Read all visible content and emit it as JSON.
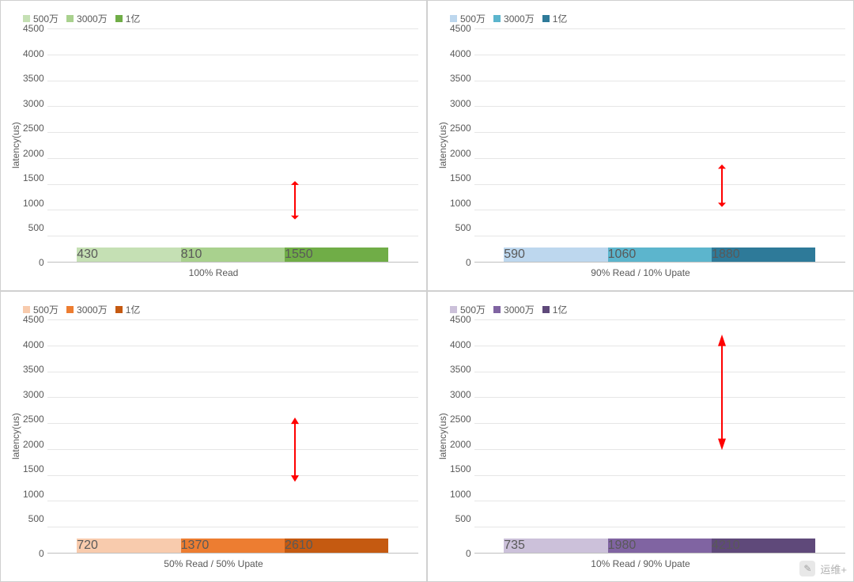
{
  "legend_labels": [
    "500万",
    "3000万",
    "1亿"
  ],
  "ylabel": "latency(us)",
  "ymax": 4500,
  "ystep": 500,
  "watermark": "运维+",
  "panels": [
    {
      "id": "p0",
      "xlabel": "100% Read",
      "colors": [
        "#c5e0b4",
        "#a9d18e",
        "#70ad47"
      ],
      "values": [
        430,
        810,
        1550
      ]
    },
    {
      "id": "p1",
      "xlabel": "90% Read / 10% Upate",
      "colors": [
        "#bdd7ee",
        "#5cb5cd",
        "#2e7a99"
      ],
      "values": [
        590,
        1060,
        1880
      ]
    },
    {
      "id": "p2",
      "xlabel": "50% Read / 50% Upate",
      "colors": [
        "#f8cbad",
        "#ed7d31",
        "#c55a11"
      ],
      "values": [
        720,
        1370,
        2610
      ]
    },
    {
      "id": "p3",
      "xlabel": "10% Read / 90% Upate",
      "colors": [
        "#ccc1da",
        "#8064a2",
        "#5f497a"
      ],
      "values": [
        735,
        1980,
        4210
      ]
    }
  ],
  "chart_data": [
    {
      "type": "bar",
      "title": "",
      "xlabel": "100% Read",
      "ylabel": "latency(us)",
      "ylim": [
        0,
        4500
      ],
      "categories": [
        "500万",
        "3000万",
        "1亿"
      ],
      "values": [
        430,
        810,
        1550
      ]
    },
    {
      "type": "bar",
      "title": "",
      "xlabel": "90% Read / 10% Upate",
      "ylabel": "latency(us)",
      "ylim": [
        0,
        4500
      ],
      "categories": [
        "500万",
        "3000万",
        "1亿"
      ],
      "values": [
        590,
        1060,
        1880
      ]
    },
    {
      "type": "bar",
      "title": "",
      "xlabel": "50% Read / 50% Upate",
      "ylabel": "latency(us)",
      "ylim": [
        0,
        4500
      ],
      "categories": [
        "500万",
        "3000万",
        "1亿"
      ],
      "values": [
        720,
        1370,
        2610
      ]
    },
    {
      "type": "bar",
      "title": "",
      "xlabel": "10% Read / 90% Upate",
      "ylabel": "latency(us)",
      "ylim": [
        0,
        4500
      ],
      "categories": [
        "500万",
        "3000万",
        "1亿"
      ],
      "values": [
        735,
        1980,
        4210
      ]
    }
  ]
}
